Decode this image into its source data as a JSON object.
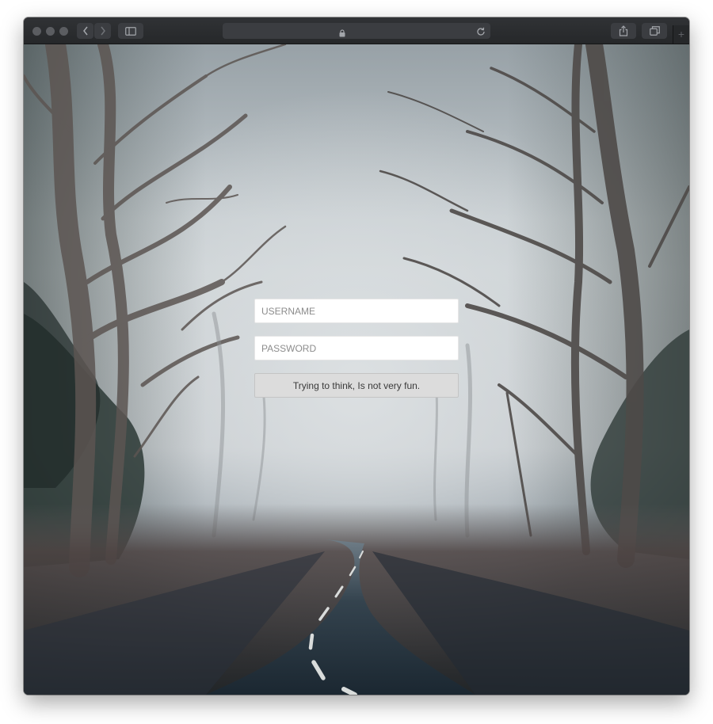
{
  "browser": {
    "url": "",
    "icons": {
      "back": "chevron-left-icon",
      "forward": "chevron-right-icon",
      "sidebar": "sidebar-icon",
      "lock": "lock-icon",
      "reload": "reload-icon",
      "share": "share-icon",
      "tabs": "tabs-overview-icon",
      "new_tab": "plus-icon"
    }
  },
  "page": {
    "background": "foggy-forest-road-photo",
    "colors": {
      "fog": "#c9ced2",
      "road": "#1d2a33",
      "foliage": "#2b3a36"
    },
    "login": {
      "username_placeholder": "USERNAME",
      "password_placeholder": "PASSWORD",
      "submit_label": "Trying to think, Is not very fun."
    }
  }
}
